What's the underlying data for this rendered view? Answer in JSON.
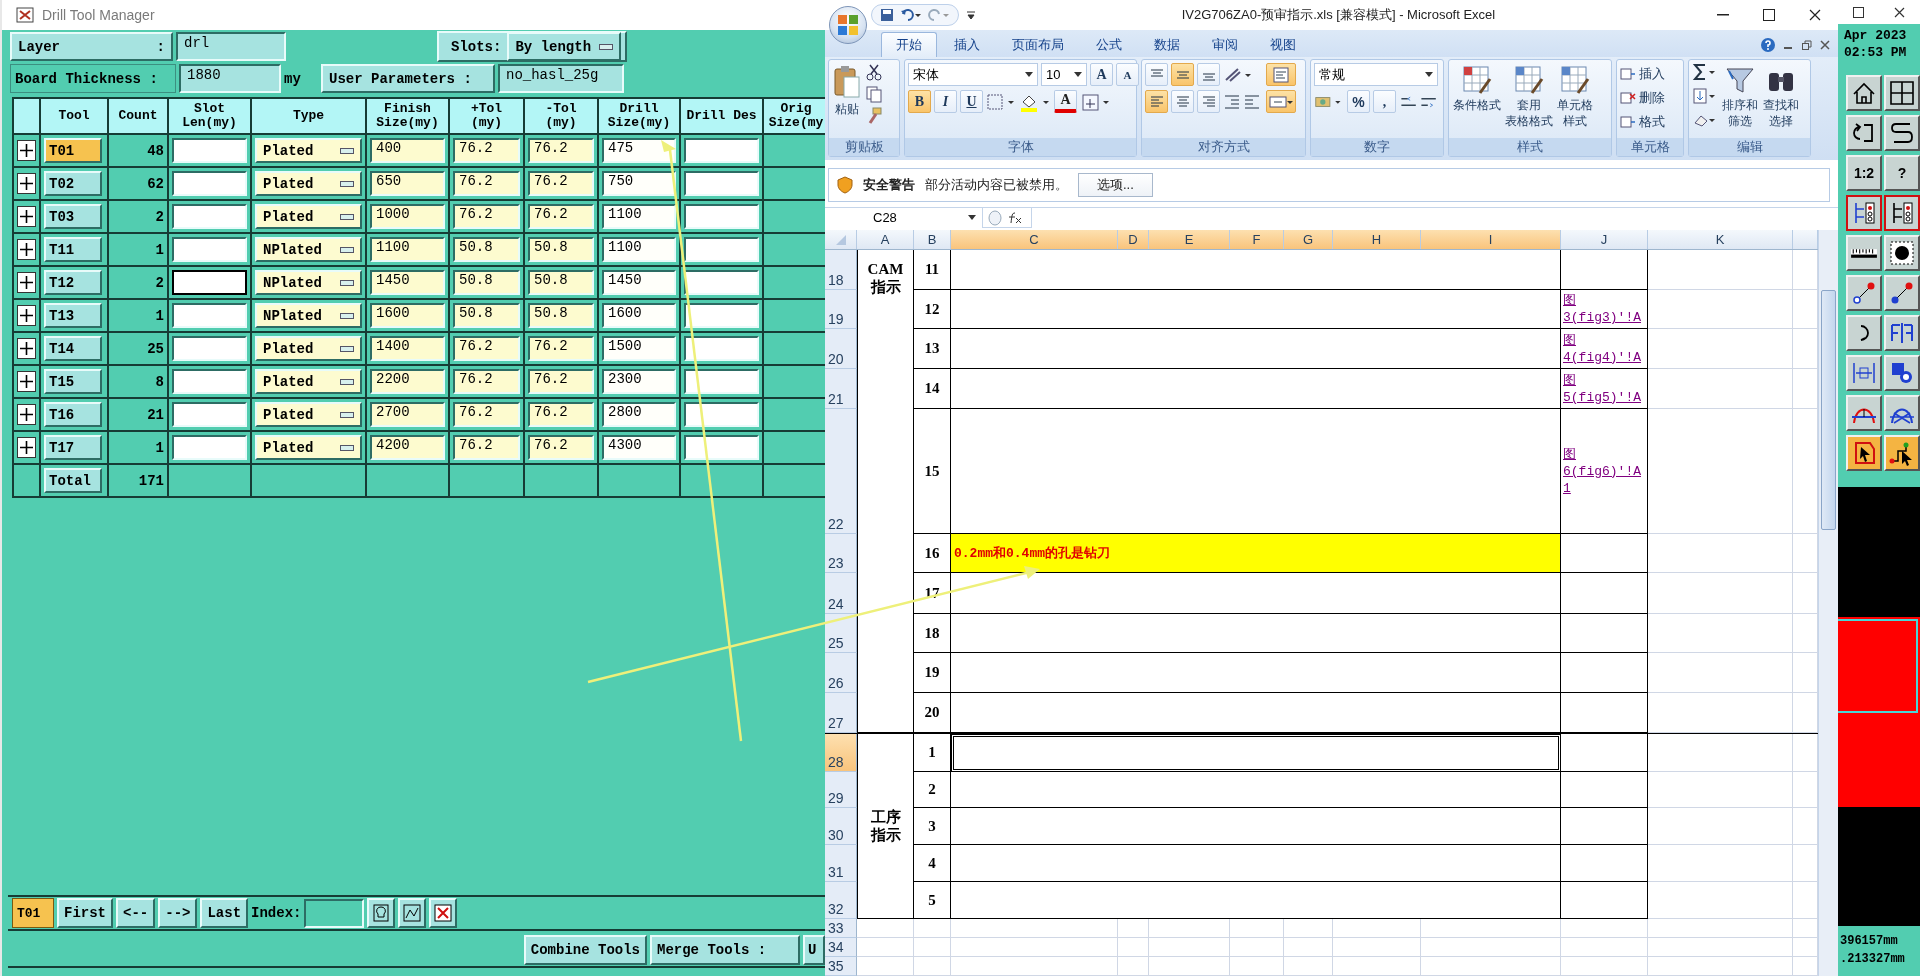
{
  "drill_window": {
    "title": "Drill Tool Manager",
    "layer": {
      "label": "Layer",
      "colon": ":",
      "value": "drl"
    },
    "slots": {
      "label": "Slots:",
      "value": "By length"
    },
    "board_thickness": {
      "label": "Board Thickness :",
      "value": "1880",
      "unit": "my"
    },
    "user_parameters": {
      "label": "User Parameters :",
      "value": "no_hasl_25g"
    },
    "columns": [
      "Tool",
      "Count",
      "Slot Len(my)",
      "Type",
      "Finish Size(my)",
      "+Tol (my)",
      "-Tol (my)",
      "Drill Size(my)",
      "Drill Des",
      "Orig Size(my"
    ],
    "rows": [
      {
        "tool": "T01",
        "selected": true,
        "count": "48",
        "slot_focused": false,
        "type": "Plated",
        "finish": "400",
        "plus_tol": "76.2",
        "minus_tol": "76.2",
        "drill_size": "475"
      },
      {
        "tool": "T02",
        "selected": false,
        "count": "62",
        "slot_focused": false,
        "type": "Plated",
        "finish": "650",
        "plus_tol": "76.2",
        "minus_tol": "76.2",
        "drill_size": "750"
      },
      {
        "tool": "T03",
        "selected": false,
        "count": "2",
        "slot_focused": false,
        "type": "Plated",
        "finish": "1000",
        "plus_tol": "76.2",
        "minus_tol": "76.2",
        "drill_size": "1100"
      },
      {
        "tool": "T11",
        "selected": false,
        "count": "1",
        "slot_focused": false,
        "type": "NPlated",
        "finish": "1100",
        "plus_tol": "50.8",
        "minus_tol": "50.8",
        "drill_size": "1100"
      },
      {
        "tool": "T12",
        "selected": false,
        "count": "2",
        "slot_focused": true,
        "type": "NPlated",
        "finish": "1450",
        "plus_tol": "50.8",
        "minus_tol": "50.8",
        "drill_size": "1450"
      },
      {
        "tool": "T13",
        "selected": false,
        "count": "1",
        "slot_focused": false,
        "type": "NPlated",
        "finish": "1600",
        "plus_tol": "50.8",
        "minus_tol": "50.8",
        "drill_size": "1600"
      },
      {
        "tool": "T14",
        "selected": false,
        "count": "25",
        "slot_focused": false,
        "type": "Plated",
        "finish": "1400",
        "plus_tol": "76.2",
        "minus_tol": "76.2",
        "drill_size": "1500"
      },
      {
        "tool": "T15",
        "selected": false,
        "count": "8",
        "slot_focused": false,
        "type": "Plated",
        "finish": "2200",
        "plus_tol": "76.2",
        "minus_tol": "76.2",
        "drill_size": "2300"
      },
      {
        "tool": "T16",
        "selected": false,
        "count": "21",
        "slot_focused": false,
        "type": "Plated",
        "finish": "2700",
        "plus_tol": "76.2",
        "minus_tol": "76.2",
        "drill_size": "2800"
      },
      {
        "tool": "T17",
        "selected": false,
        "count": "1",
        "slot_focused": false,
        "type": "Plated",
        "finish": "4200",
        "plus_tol": "76.2",
        "minus_tol": "76.2",
        "drill_size": "4300"
      }
    ],
    "total": {
      "label": "Total",
      "count": "171"
    },
    "navigator": {
      "current": "T01",
      "buttons": [
        "First",
        "<--",
        "-->",
        "Last"
      ],
      "index_label": "Index:"
    },
    "actions": {
      "combine": "Combine Tools",
      "merge": "Merge Tools :",
      "cut_button": "U"
    }
  },
  "excel": {
    "title": "IV2G706ZA0-预审指示.xls  [兼容模式] - Microsoft Excel",
    "tabs": [
      {
        "label": "开始",
        "selected": true
      },
      {
        "label": "插入",
        "selected": false
      },
      {
        "label": "页面布局",
        "selected": false
      },
      {
        "label": "公式",
        "selected": false
      },
      {
        "label": "数据",
        "selected": false
      },
      {
        "label": "审阅",
        "selected": false
      },
      {
        "label": "视图",
        "selected": false
      }
    ],
    "ribbon": [
      {
        "kind": "clipboard",
        "label": "剪贴板",
        "paste": "粘贴"
      },
      {
        "kind": "font",
        "label": "字体",
        "font": "宋体",
        "size": "10",
        "grow": "A",
        "shrink": "A",
        "format_buttons": [
          {
            "label": "B",
            "on": true
          },
          {
            "label": "I",
            "on": false
          },
          {
            "label": "U",
            "on": false
          }
        ],
        "color_letter": "A"
      },
      {
        "kind": "alignment",
        "label": "对齐方式",
        "valign": [
          {
            "selected": false
          },
          {
            "selected": true
          },
          {
            "selected": false
          }
        ],
        "halign": [
          {
            "selected": true
          },
          {
            "selected": false
          },
          {
            "selected": false
          }
        ],
        "wrap_on": true,
        "merge_on": true
      },
      {
        "kind": "number",
        "label": "数字",
        "format": "常规",
        "percent": "%",
        "comma": ","
      },
      {
        "kind": "styles",
        "label": "样式",
        "buttons": [
          [
            "条件格式"
          ],
          [
            "套用",
            "表格格式"
          ],
          [
            "单元格",
            "样式"
          ]
        ]
      },
      {
        "kind": "cells",
        "label": "单元格",
        "buttons": [
          "插入",
          "删除",
          "格式"
        ]
      },
      {
        "kind": "editing",
        "label": "编辑",
        "buttons": [
          [
            "排序和",
            "筛选"
          ],
          [
            "查找和",
            "选择"
          ]
        ]
      }
    ],
    "security": {
      "title": "安全警告",
      "message": "部分活动内容已被禁用。",
      "button": "选项..."
    },
    "name_box": "C28",
    "columns": [
      {
        "label": "A",
        "selected": false
      },
      {
        "label": "B",
        "selected": false
      },
      {
        "label": "C",
        "selected": true
      },
      {
        "label": "D",
        "selected": true
      },
      {
        "label": "E",
        "selected": true
      },
      {
        "label": "F",
        "selected": true
      },
      {
        "label": "G",
        "selected": true
      },
      {
        "label": "H",
        "selected": true
      },
      {
        "label": "I",
        "selected": true
      },
      {
        "label": "J",
        "selected": false
      },
      {
        "label": "K",
        "selected": false
      }
    ],
    "sections": [
      {
        "label": "CAM指示",
        "rows": [
          {
            "row": "18",
            "item": "11",
            "highlighted": false,
            "selected": false
          },
          {
            "row": "19",
            "item": "12",
            "link": "图3(fig3)'!A",
            "highlighted": false,
            "selected": false
          },
          {
            "row": "20",
            "item": "13",
            "link": "图4(fig4)'!A",
            "highlighted": false,
            "selected": false
          },
          {
            "row": "21",
            "item": "14",
            "link": "图5(fig5)'!A",
            "highlighted": false,
            "selected": false
          },
          {
            "row": "22",
            "item": "15",
            "link": "图6(fig6)'!A1",
            "highlighted": false,
            "selected": false
          },
          {
            "row": "23",
            "item": "16",
            "note": "0.2mm和0.4mm的孔是钻刀",
            "highlighted": true,
            "selected": false
          },
          {
            "row": "24",
            "item": "17",
            "highlighted": false,
            "selected": false
          },
          {
            "row": "25",
            "item": "18",
            "highlighted": false,
            "selected": false
          },
          {
            "row": "26",
            "item": "19",
            "highlighted": false,
            "selected": false
          },
          {
            "row": "27",
            "item": "20",
            "highlighted": false,
            "selected": false
          }
        ]
      },
      {
        "label": "工序指示",
        "rows": [
          {
            "row": "28",
            "item": "1",
            "highlighted": false,
            "selected": true
          },
          {
            "row": "29",
            "item": "2",
            "highlighted": false,
            "selected": false
          },
          {
            "row": "30",
            "item": "3",
            "highlighted": false,
            "selected": false
          },
          {
            "row": "31",
            "item": "4",
            "highlighted": false,
            "selected": false
          },
          {
            "row": "32",
            "item": "5",
            "highlighted": false,
            "selected": false
          }
        ]
      }
    ],
    "extra_rows": [
      "33",
      "34",
      "35"
    ]
  },
  "right_panel": {
    "date": "Apr 2023",
    "time": "02:53 PM",
    "palette_labels": [
      "1:2",
      "?"
    ],
    "coords": [
      "396157mm",
      ".213327mm"
    ]
  }
}
